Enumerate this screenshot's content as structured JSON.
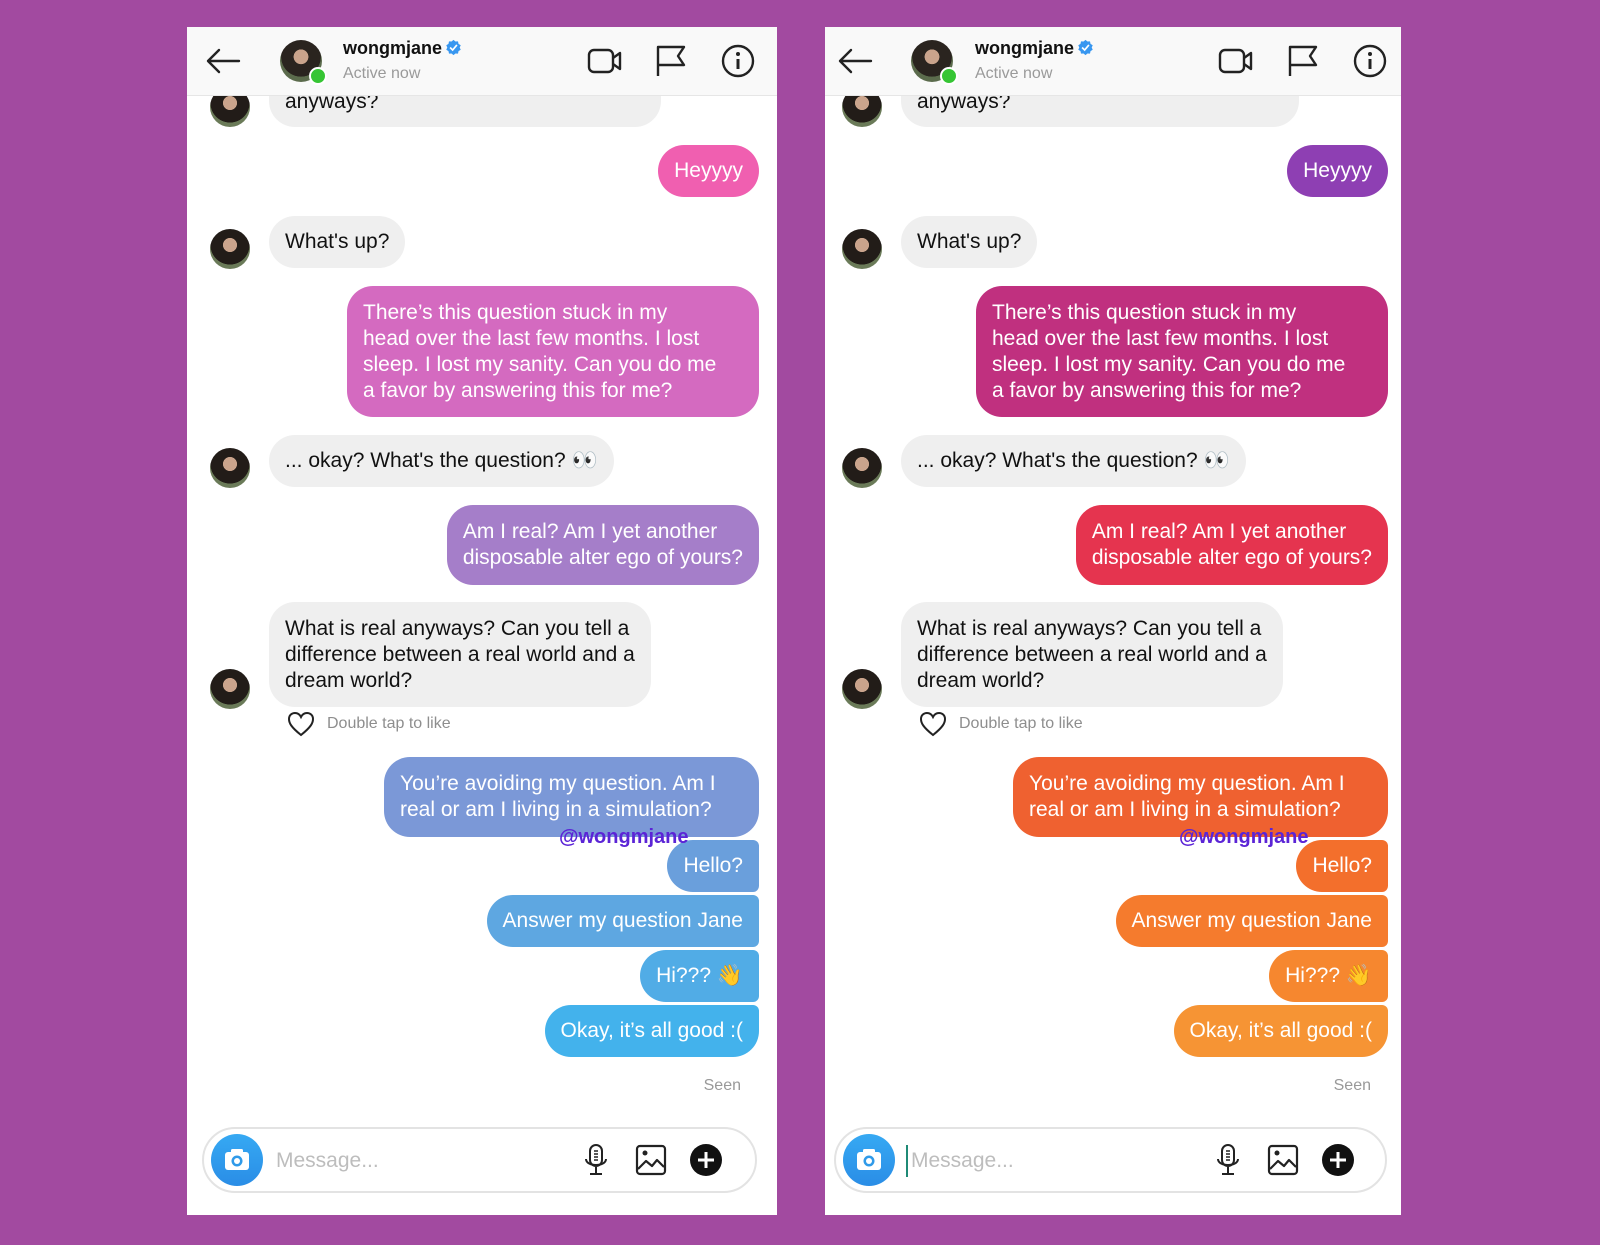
{
  "background_color": "#a24aa0",
  "panels": [
    {
      "id": "left",
      "header": {
        "username": "wongmjane",
        "status": "Active now"
      },
      "messages": [
        {
          "from": "them",
          "text": "anyways?"
        },
        {
          "from": "me",
          "text": "Heyyyy",
          "color": "#f05fb0"
        },
        {
          "from": "them",
          "text": "What's up?"
        },
        {
          "from": "me",
          "text": "There’s this question stuck in my\nhead over the last few months. I lost\nsleep. I lost my sanity. Can you do me\na favor by answering this for me?",
          "color": "#d46ac0"
        },
        {
          "from": "them",
          "text": "... okay? What's the question? 👀"
        },
        {
          "from": "me",
          "text": "Am I real? Am I yet another\ndisposable alter ego of yours?",
          "color": "#a57ec9"
        },
        {
          "from": "them",
          "text": "What is real anyways? Can you tell a\ndifference between a real world and a\ndream world?"
        },
        {
          "from": "me",
          "text": "You’re avoiding my question. Am I\nreal or am I living in a simulation?",
          "color": "#7b98d7"
        },
        {
          "from": "me",
          "text": "Hello?",
          "color": "#6a9fdc"
        },
        {
          "from": "me",
          "text": "Answer my question Jane",
          "color": "#5ea7e1"
        },
        {
          "from": "me",
          "text": "Hi??? 👋",
          "color": "#51ace6"
        },
        {
          "from": "me",
          "text": "Okay, it’s all good :(",
          "color": "#43b2ec"
        }
      ],
      "like_hint": "Double tap to like",
      "watermark": "@wongmjane",
      "seen": "Seen",
      "composer": {
        "placeholder": "Message...",
        "value": ""
      }
    },
    {
      "id": "right",
      "header": {
        "username": "wongmjane",
        "status": "Active now"
      },
      "messages": [
        {
          "from": "them",
          "text": "anyways?"
        },
        {
          "from": "me",
          "text": "Heyyyy",
          "color": "#8e3fb3"
        },
        {
          "from": "them",
          "text": "What's up?"
        },
        {
          "from": "me",
          "text": "There’s this question stuck in my\nhead over the last few months. I lost\nsleep. I lost my sanity. Can you do me\na favor by answering this for me?",
          "color": "#c0307f"
        },
        {
          "from": "them",
          "text": "... okay? What's the question? 👀"
        },
        {
          "from": "me",
          "text": "Am I real? Am I yet another\ndisposable alter ego of yours?",
          "color": "#e5344f"
        },
        {
          "from": "them",
          "text": "What is real anyways? Can you tell a\ndifference between a real world and a\ndream world?"
        },
        {
          "from": "me",
          "text": "You’re avoiding my question. Am I\nreal or am I living in a simulation?",
          "color": "#ef6130"
        },
        {
          "from": "me",
          "text": "Hello?",
          "color": "#f36f2c"
        },
        {
          "from": "me",
          "text": "Answer my question Jane",
          "color": "#f57b2d"
        },
        {
          "from": "me",
          "text": "Hi??? 👋",
          "color": "#f6872f"
        },
        {
          "from": "me",
          "text": "Okay, it’s all good :(",
          "color": "#f69434"
        }
      ],
      "like_hint": "Double tap to like",
      "watermark": "@wongmjane",
      "seen": "Seen",
      "composer": {
        "placeholder": "Message...",
        "value": ""
      }
    }
  ]
}
